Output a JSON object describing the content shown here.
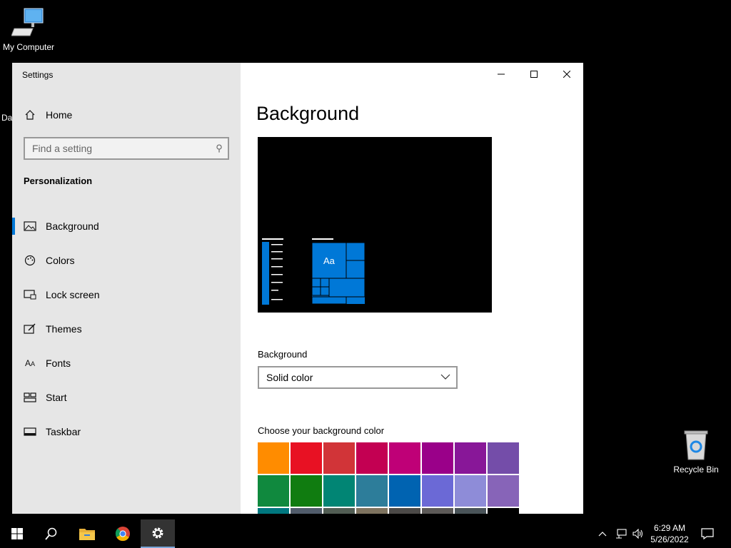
{
  "desktop": {
    "my_computer_label": "My Computer",
    "partial_label": "Da",
    "recycle_bin_label": "Recycle Bin"
  },
  "window": {
    "title": "Settings",
    "home_label": "Home",
    "search_placeholder": "Find a setting",
    "section_title": "Personalization",
    "nav": [
      {
        "label": "Background",
        "icon": "image-icon"
      },
      {
        "label": "Colors",
        "icon": "palette-icon"
      },
      {
        "label": "Lock screen",
        "icon": "lock-screen-icon"
      },
      {
        "label": "Themes",
        "icon": "themes-icon"
      },
      {
        "label": "Fonts",
        "icon": "fonts-icon"
      },
      {
        "label": "Start",
        "icon": "start-icon"
      },
      {
        "label": "Taskbar",
        "icon": "taskbar-icon"
      }
    ]
  },
  "content": {
    "page_title": "Background",
    "preview_tile_text": "Aa",
    "background_label": "Background",
    "background_value": "Solid color",
    "color_label": "Choose your background color",
    "swatches": [
      "#ff8c00",
      "#e81123",
      "#d13438",
      "#c30052",
      "#bf0077",
      "#9a0089",
      "#881798",
      "#744da9",
      "#10893e",
      "#107c10",
      "#018574",
      "#2d7d9a",
      "#0063b1",
      "#6b69d6",
      "#8e8cd8",
      "#8764b8",
      "#00777f",
      "#515c6b",
      "#525e54",
      "#7e735f",
      "#4c4a48",
      "#5d5a58",
      "#4a5459",
      "#000000"
    ]
  },
  "taskbar": {
    "time": "6:29 AM",
    "date": "5/26/2022"
  },
  "colors": {
    "accent": "#0078d7",
    "sidebar_bg": "#e6e6e6"
  }
}
